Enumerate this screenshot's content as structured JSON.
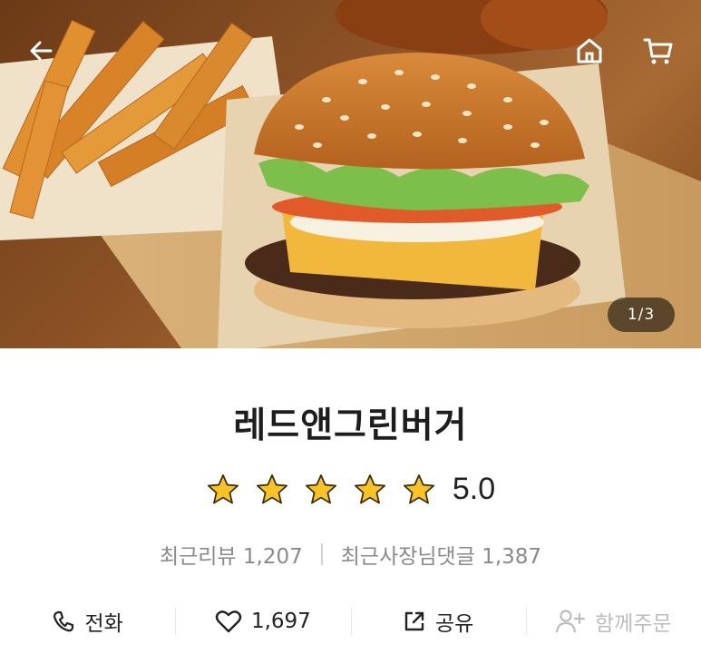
{
  "hero": {
    "image_alt": "burger-and-fries-photo",
    "counter": "1/3",
    "back_icon": "arrow-left-icon",
    "home_icon": "home-icon",
    "cart_icon": "cart-icon"
  },
  "store": {
    "name": "레드앤그린버거",
    "rating_value": 5.0,
    "rating_text": "5.0",
    "star_color": "#f7c325"
  },
  "counts": {
    "reviews": "최근리뷰 1,207",
    "owner_comments": "최근사장님댓글 1,387"
  },
  "actions": {
    "call": {
      "label": "전화",
      "icon": "phone-icon"
    },
    "like": {
      "label": "1,697",
      "icon": "heart-icon"
    },
    "share": {
      "label": "공유",
      "icon": "share-icon"
    },
    "group_order": {
      "label": "함께주문",
      "icon": "add-person-icon"
    }
  }
}
